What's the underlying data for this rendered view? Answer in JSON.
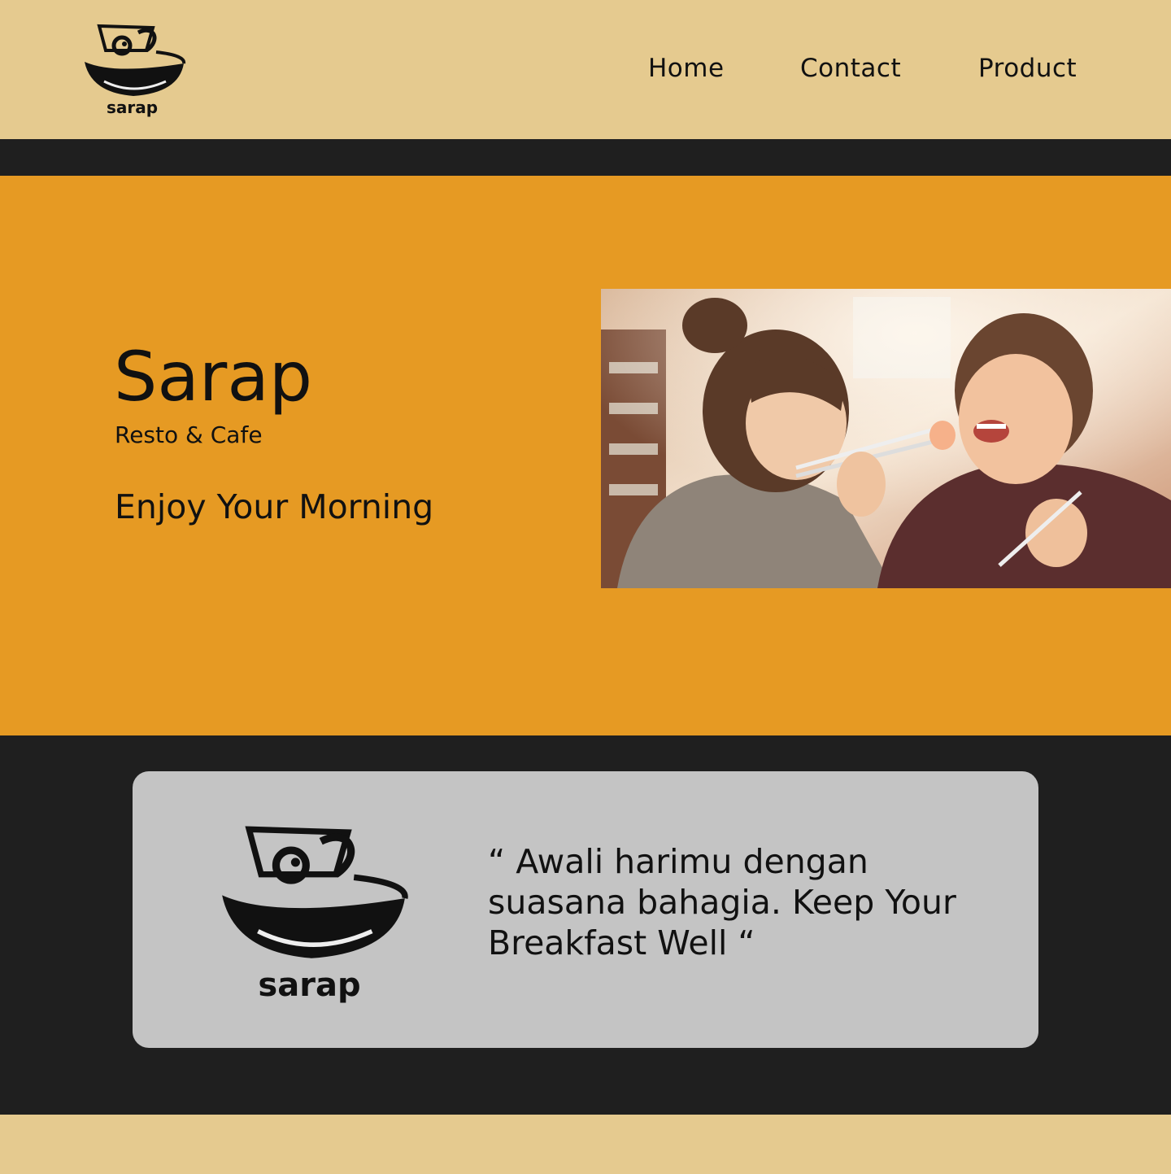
{
  "header": {
    "logo_text": "sarap",
    "nav": {
      "home": "Home",
      "contact": "Contact",
      "product": "Product"
    }
  },
  "hero": {
    "title": "Sarap",
    "subtitle": "Resto & Cafe",
    "tagline": "Enjoy Your Morning"
  },
  "quote_card": {
    "logo_text": "sarap",
    "quote": "“ Awali harimu dengan suasana bahagia. Keep Your Breakfast Well “"
  },
  "colors": {
    "header_bg": "#e5ca8f",
    "hero_bg": "#e69a23",
    "dark_band": "#1f1f1f",
    "card_bg": "#c4c4c4"
  }
}
